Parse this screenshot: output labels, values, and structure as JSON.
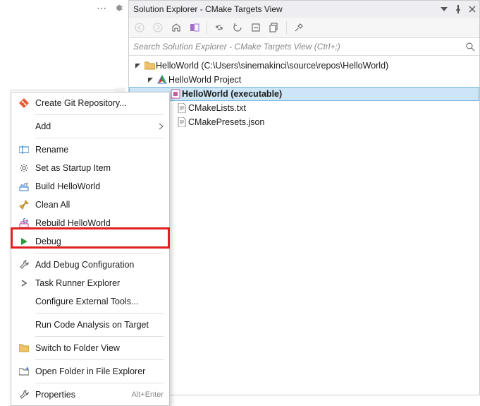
{
  "leftbar": {
    "more_icon": "more",
    "gear_icon": "gear"
  },
  "panel": {
    "title": "Solution Explorer - CMake Targets View",
    "win": {
      "dropdown": "chevron-down",
      "pin": "pin",
      "close": "close"
    },
    "toolbar": {
      "back": "back",
      "forward": "forward",
      "home": "home",
      "switch_views": "switch-views",
      "sync": "sync",
      "refresh": "refresh",
      "collapse": "collapse",
      "show_all": "show-all",
      "properties": "properties"
    },
    "search": {
      "placeholder": "Search Solution Explorer - CMake Targets View (Ctrl+;)"
    },
    "tree": {
      "root": {
        "label": "HelloWorld (C:\\Users\\sinemakinci\\source\\repos\\HelloWorld)"
      },
      "project": {
        "label": "HelloWorld Project"
      },
      "target": {
        "label": "HelloWorld (executable)"
      },
      "files": [
        {
          "label": "CMakeLists.txt"
        },
        {
          "label": "CMakePresets.json"
        }
      ]
    }
  },
  "ctx": {
    "create_git": "Create Git Repository...",
    "add": "Add",
    "rename": "Rename",
    "startup": "Set as Startup Item",
    "build": "Build HelloWorld",
    "clean": "Clean All",
    "rebuild": "Rebuild HelloWorld",
    "debug": "Debug",
    "add_debug_cfg": "Add Debug Configuration",
    "task_runner": "Task Runner Explorer",
    "configure_tools": "Configure External Tools...",
    "run_analysis": "Run Code Analysis on Target",
    "folder_view": "Switch to Folder View",
    "open_explorer": "Open Folder in File Explorer",
    "properties": "Properties",
    "properties_shortcut": "Alt+Enter"
  }
}
